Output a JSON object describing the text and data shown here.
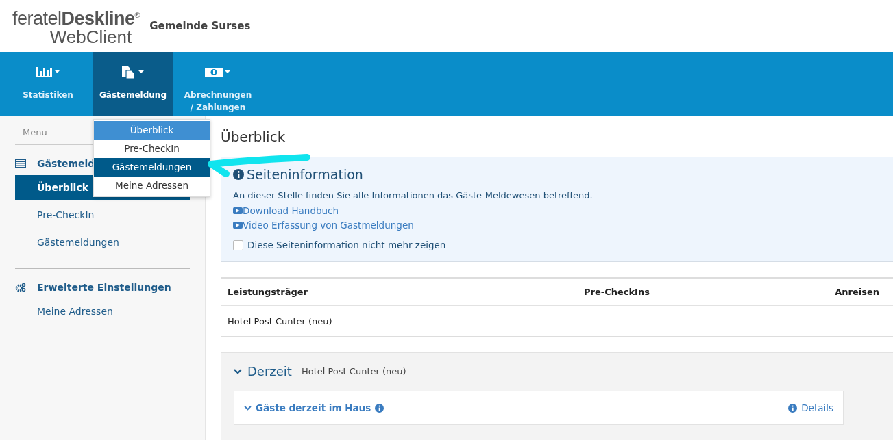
{
  "brand": {
    "logo_light": "feratel",
    "logo_bold": "Deskline",
    "logo_mark": "®",
    "logo_sub": "WebClient",
    "org": "Gemeinde Surses"
  },
  "nav": [
    {
      "label": "Statistiken",
      "kind": "chart",
      "selected": false
    },
    {
      "label": "Gästemeldung",
      "kind": "documents",
      "selected": true
    },
    {
      "label": "Abrechnungen / Zahlungen",
      "kind": "money",
      "selected": false
    }
  ],
  "dropdown": [
    {
      "label": "Überblick",
      "selected": true,
      "hovered": false
    },
    {
      "label": "Pre-CheckIn",
      "selected": false,
      "hovered": false
    },
    {
      "label": "Gästemeldungen",
      "selected": false,
      "hovered": true
    },
    {
      "label": "Meine Adressen",
      "selected": false,
      "hovered": false
    }
  ],
  "sidebar": {
    "title": "Menu",
    "groups": [
      {
        "label": "Gästemeld",
        "kind": "list",
        "items": [
          {
            "label": "Überblick",
            "selected": true
          },
          {
            "label": "Pre-CheckIn",
            "selected": false
          },
          {
            "label": "Gästemeldungen",
            "selected": false
          }
        ]
      },
      {
        "label": "Erweiterte Einstellungen",
        "kind": "gears",
        "items": [
          {
            "label": "Meine Adressen",
            "selected": false
          }
        ]
      }
    ]
  },
  "page_title": "Überblick",
  "info": {
    "title": "Seiteninformation",
    "text": "An dieser Stelle finden Sie alle Informationen das Gäste-Meldewesen betreffend.",
    "links": [
      "Download Handbuch",
      "Video Erfassung von Gastmeldungen"
    ],
    "checkbox": {
      "label": "Diese Seiteninformation nicht mehr zeigen",
      "checked": false
    }
  },
  "table": {
    "columns": [
      "Leistungsträger",
      "Pre-CheckIns",
      "Anreisen"
    ],
    "rows": [
      [
        "Hotel Post Cunter (neu)",
        "",
        ""
      ]
    ]
  },
  "current": {
    "title": "Derzeit",
    "subtitle": "Hotel Post Cunter (neu)",
    "expanded": true,
    "panel": {
      "title": "Gäste derzeit im Haus",
      "expanded": true,
      "details": "Details"
    }
  }
}
